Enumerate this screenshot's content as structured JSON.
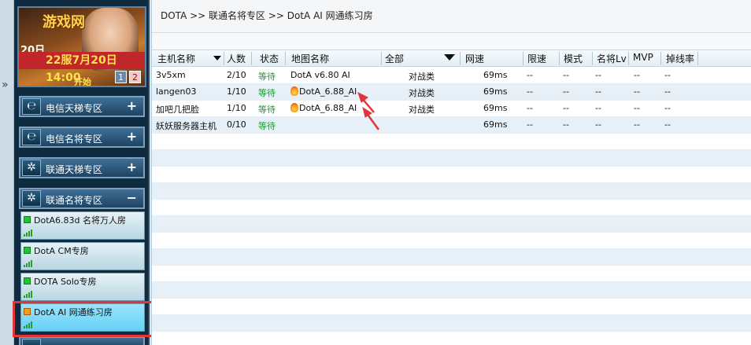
{
  "nav": {
    "collapse_arrows": "»"
  },
  "banner": {
    "title_art": "游戏网",
    "side_text": "20日\n00",
    "date_text": "22服7月20日14:00",
    "open_text": "开始",
    "pages": [
      "1",
      "2"
    ]
  },
  "sidebar": {
    "sections": [
      {
        "label": "电信天梯专区",
        "icon": "telecom-icon",
        "toggle": "+"
      },
      {
        "label": "电信名将专区",
        "icon": "telecom-icon",
        "toggle": "+"
      },
      {
        "label": "联通天梯专区",
        "icon": "unicom-icon",
        "toggle": "+"
      },
      {
        "label": "联通名将专区",
        "icon": "unicom-icon",
        "toggle": "−"
      }
    ],
    "rooms": [
      {
        "label": "DotA6.83d 名将万人房",
        "status_color": "#22c43a"
      },
      {
        "label": "DotA CM专房",
        "status_color": "#22c43a"
      },
      {
        "label": "DOTA Solo专房",
        "status_color": "#22c43a"
      },
      {
        "label": "DotA AI 网通练习房",
        "status_color": "#f39a24",
        "selected": true
      }
    ]
  },
  "breadcrumb": "DOTA >> 联通名将专区 >> DotA AI 网通练习房",
  "table": {
    "columns": [
      "主机名称",
      "人数",
      "状态",
      "地图名称",
      "全部",
      "网速",
      "限速",
      "模式",
      "名将Lv",
      "MVP",
      "掉线率"
    ],
    "rows": [
      {
        "host": "3v5xm",
        "players": "2/10",
        "status": "等待",
        "map": "DotA v6.80 AI",
        "map_icon": false,
        "type": "对战类",
        "ping": "69ms",
        "limit": "--",
        "mode": "--",
        "lv": "--",
        "mvp": "--",
        "drop": "--"
      },
      {
        "host": "langen03",
        "players": "1/10",
        "status": "等待",
        "map": "DotA_6.88_AI",
        "map_icon": true,
        "type": "对战类",
        "ping": "69ms",
        "limit": "--",
        "mode": "--",
        "lv": "--",
        "mvp": "--",
        "drop": "--"
      },
      {
        "host": "加吧几把脸",
        "players": "1/10",
        "status": "等待",
        "map": "DotA_6.88_AI",
        "map_icon": true,
        "type": "对战类",
        "ping": "69ms",
        "limit": "--",
        "mode": "--",
        "lv": "--",
        "mvp": "--",
        "drop": "--"
      },
      {
        "host": "妖妖服务器主机",
        "players": "0/10",
        "status": "等待",
        "map": "",
        "map_icon": false,
        "type": "",
        "ping": "69ms",
        "limit": "--",
        "mode": "--",
        "lv": "--",
        "mvp": "--",
        "drop": "--"
      }
    ]
  },
  "colors": {
    "status_waiting": "#1a9b2a",
    "highlight": "#e0353a",
    "sidebar_bg": "#0f2b40"
  }
}
